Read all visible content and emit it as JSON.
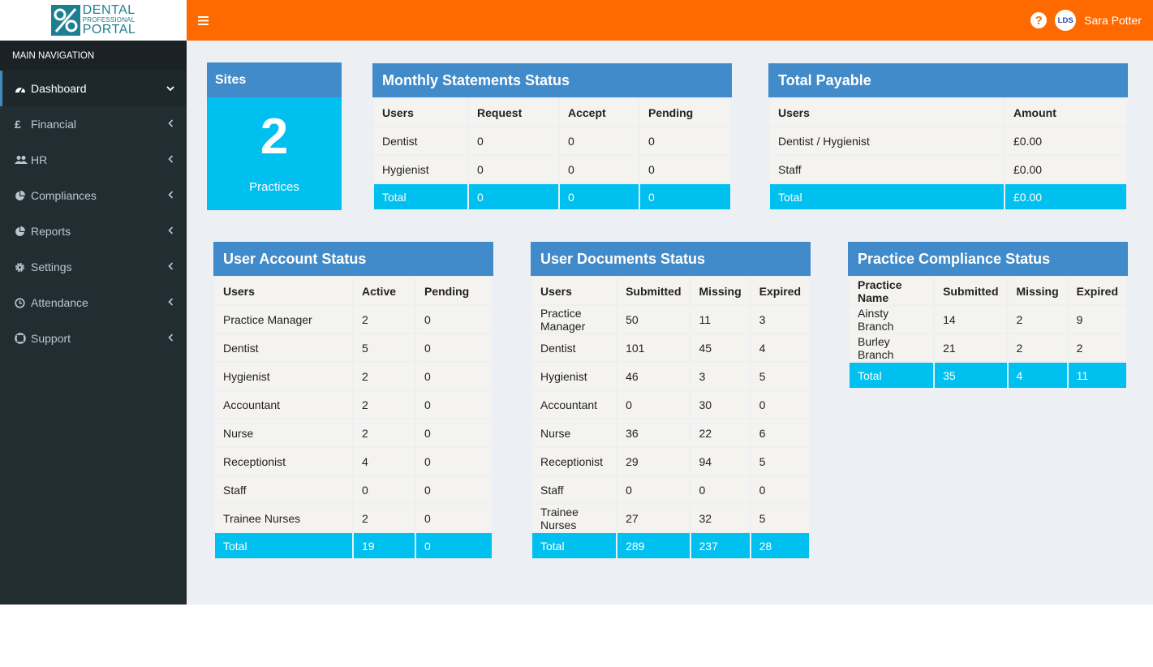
{
  "brand": {
    "line1": "DENTAL",
    "line2": "PROFESSIONAL",
    "line3": "PORTAL"
  },
  "sidebar": {
    "header": "MAIN NAVIGATION",
    "items": [
      {
        "label": "Dashboard",
        "icon": "dashboard-icon"
      },
      {
        "label": "Financial",
        "icon": "pound-icon"
      },
      {
        "label": "HR",
        "icon": "users-icon"
      },
      {
        "label": "Compliances",
        "icon": "pie-chart-icon"
      },
      {
        "label": "Reports",
        "icon": "pie-chart-icon"
      },
      {
        "label": "Settings",
        "icon": "gear-icon"
      },
      {
        "label": "Attendance",
        "icon": "clock-icon"
      },
      {
        "label": "Support",
        "icon": "lifebuoy-icon"
      }
    ]
  },
  "topbar": {
    "help": "?",
    "avatar": "LDS",
    "user_name": "Sara Potter"
  },
  "sites": {
    "title": "Sites",
    "count": "2",
    "label": "Practices"
  },
  "monthly": {
    "title": "Monthly Statements Status",
    "headers": [
      "Users",
      "Request",
      "Accept",
      "Pending"
    ],
    "rows": [
      [
        "Dentist",
        "0",
        "0",
        "0"
      ],
      [
        "Hygienist",
        "0",
        "0",
        "0"
      ]
    ],
    "total": [
      "Total",
      "0",
      "0",
      "0"
    ]
  },
  "payable": {
    "title": "Total Payable",
    "headers": [
      "Users",
      "Amount"
    ],
    "rows": [
      [
        "Dentist / Hygienist",
        "£0.00"
      ],
      [
        "Staff",
        "£0.00"
      ]
    ],
    "total": [
      "Total",
      "£0.00"
    ]
  },
  "account": {
    "title": "User Account Status",
    "headers": [
      "Users",
      "Active",
      "Pending"
    ],
    "rows": [
      [
        "Practice Manager",
        "2",
        "0"
      ],
      [
        "Dentist",
        "5",
        "0"
      ],
      [
        "Hygienist",
        "2",
        "0"
      ],
      [
        "Accountant",
        "2",
        "0"
      ],
      [
        "Nurse",
        "2",
        "0"
      ],
      [
        "Receptionist",
        "4",
        "0"
      ],
      [
        "Staff",
        "0",
        "0"
      ],
      [
        "Trainee Nurses",
        "2",
        "0"
      ]
    ],
    "total": [
      "Total",
      "19",
      "0"
    ]
  },
  "documents": {
    "title": "User Documents Status",
    "headers": [
      "Users",
      "Submitted",
      "Missing",
      "Expired"
    ],
    "rows": [
      [
        "Practice Manager",
        "50",
        "11",
        "3"
      ],
      [
        "Dentist",
        "101",
        "45",
        "4"
      ],
      [
        "Hygienist",
        "46",
        "3",
        "5"
      ],
      [
        "Accountant",
        "0",
        "30",
        "0"
      ],
      [
        "Nurse",
        "36",
        "22",
        "6"
      ],
      [
        "Receptionist",
        "29",
        "94",
        "5"
      ],
      [
        "Staff",
        "0",
        "0",
        "0"
      ],
      [
        "Trainee Nurses",
        "27",
        "32",
        "5"
      ]
    ],
    "total": [
      "Total",
      "289",
      "237",
      "28"
    ]
  },
  "compliance": {
    "title": "Practice Compliance Status",
    "headers": [
      "Practice Name",
      "Submitted",
      "Missing",
      "Expired"
    ],
    "rows": [
      [
        "Ainsty Branch",
        "14",
        "2",
        "9"
      ],
      [
        "Burley Branch",
        "21",
        "2",
        "2"
      ]
    ],
    "total": [
      "Total",
      "35",
      "4",
      "11"
    ]
  },
  "colors": {
    "topbar": "#ff6a00",
    "sidebar": "#222d32",
    "panel_head": "#428bca",
    "total_row": "#00c0ef"
  }
}
